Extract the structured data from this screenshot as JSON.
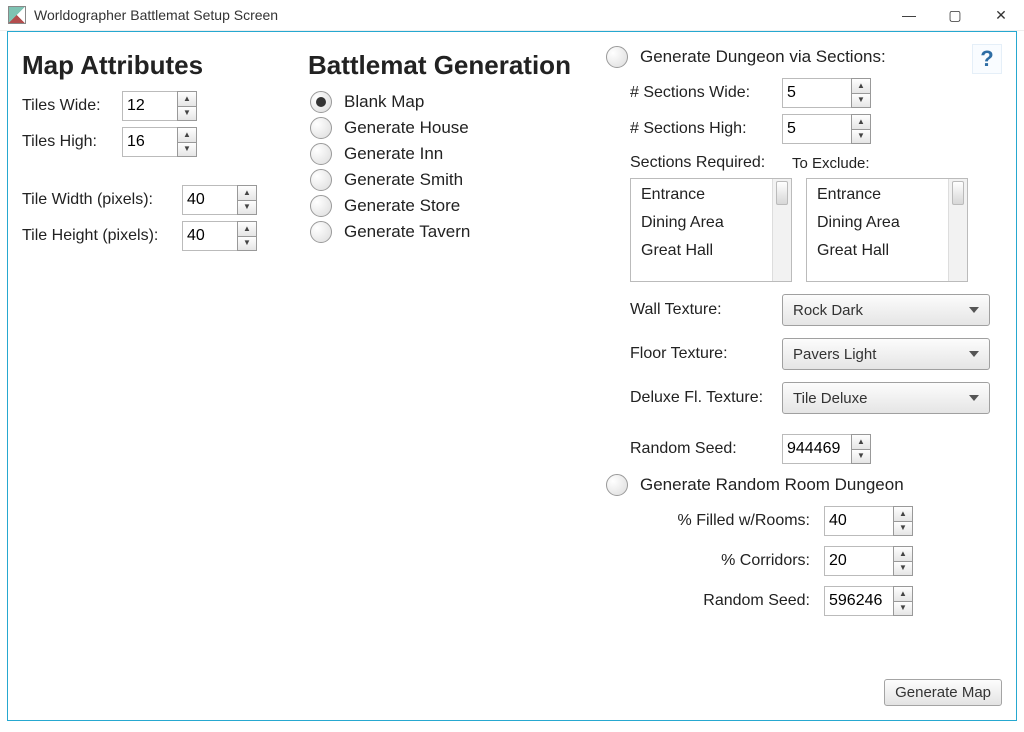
{
  "title": "Worldographer Battlemat Setup Screen",
  "col1": {
    "heading": "Map Attributes",
    "tiles_wide_label": "Tiles Wide:",
    "tiles_wide_value": "12",
    "tiles_high_label": "Tiles High:",
    "tiles_high_value": "16",
    "tile_width_label": "Tile Width (pixels):",
    "tile_width_value": "40",
    "tile_height_label": "Tile Height (pixels):",
    "tile_height_value": "40"
  },
  "col2": {
    "heading": "Battlemat Generation",
    "options": {
      "blank": "Blank Map",
      "house": "Generate House",
      "inn": "Generate Inn",
      "smith": "Generate Smith",
      "store": "Generate Store",
      "tavern": "Generate Tavern"
    },
    "selected": "blank"
  },
  "col3": {
    "option_sections_label": "Generate Dungeon via Sections:",
    "help": "?",
    "sections_wide_label": "# Sections Wide:",
    "sections_wide_value": "5",
    "sections_high_label": "# Sections High:",
    "sections_high_value": "5",
    "required_label": "Sections Required:",
    "exclude_label": "To Exclude:",
    "sections_list": [
      "Entrance",
      "Dining Area",
      "Great Hall"
    ],
    "wall_label": "Wall Texture:",
    "wall_value": "Rock Dark",
    "floor_label": "Floor Texture:",
    "floor_value": "Pavers Light",
    "deluxe_label": "Deluxe Fl. Texture:",
    "deluxe_value": "Tile Deluxe",
    "seed_label": "Random Seed:",
    "seed_value": "944469",
    "option_random_label": "Generate Random Room Dungeon",
    "filled_label": "% Filled w/Rooms:",
    "filled_value": "40",
    "corridors_label": "% Corridors:",
    "corridors_value": "20",
    "seed2_label": "Random Seed:",
    "seed2_value": "596246"
  },
  "generate_btn": "Generate Map"
}
